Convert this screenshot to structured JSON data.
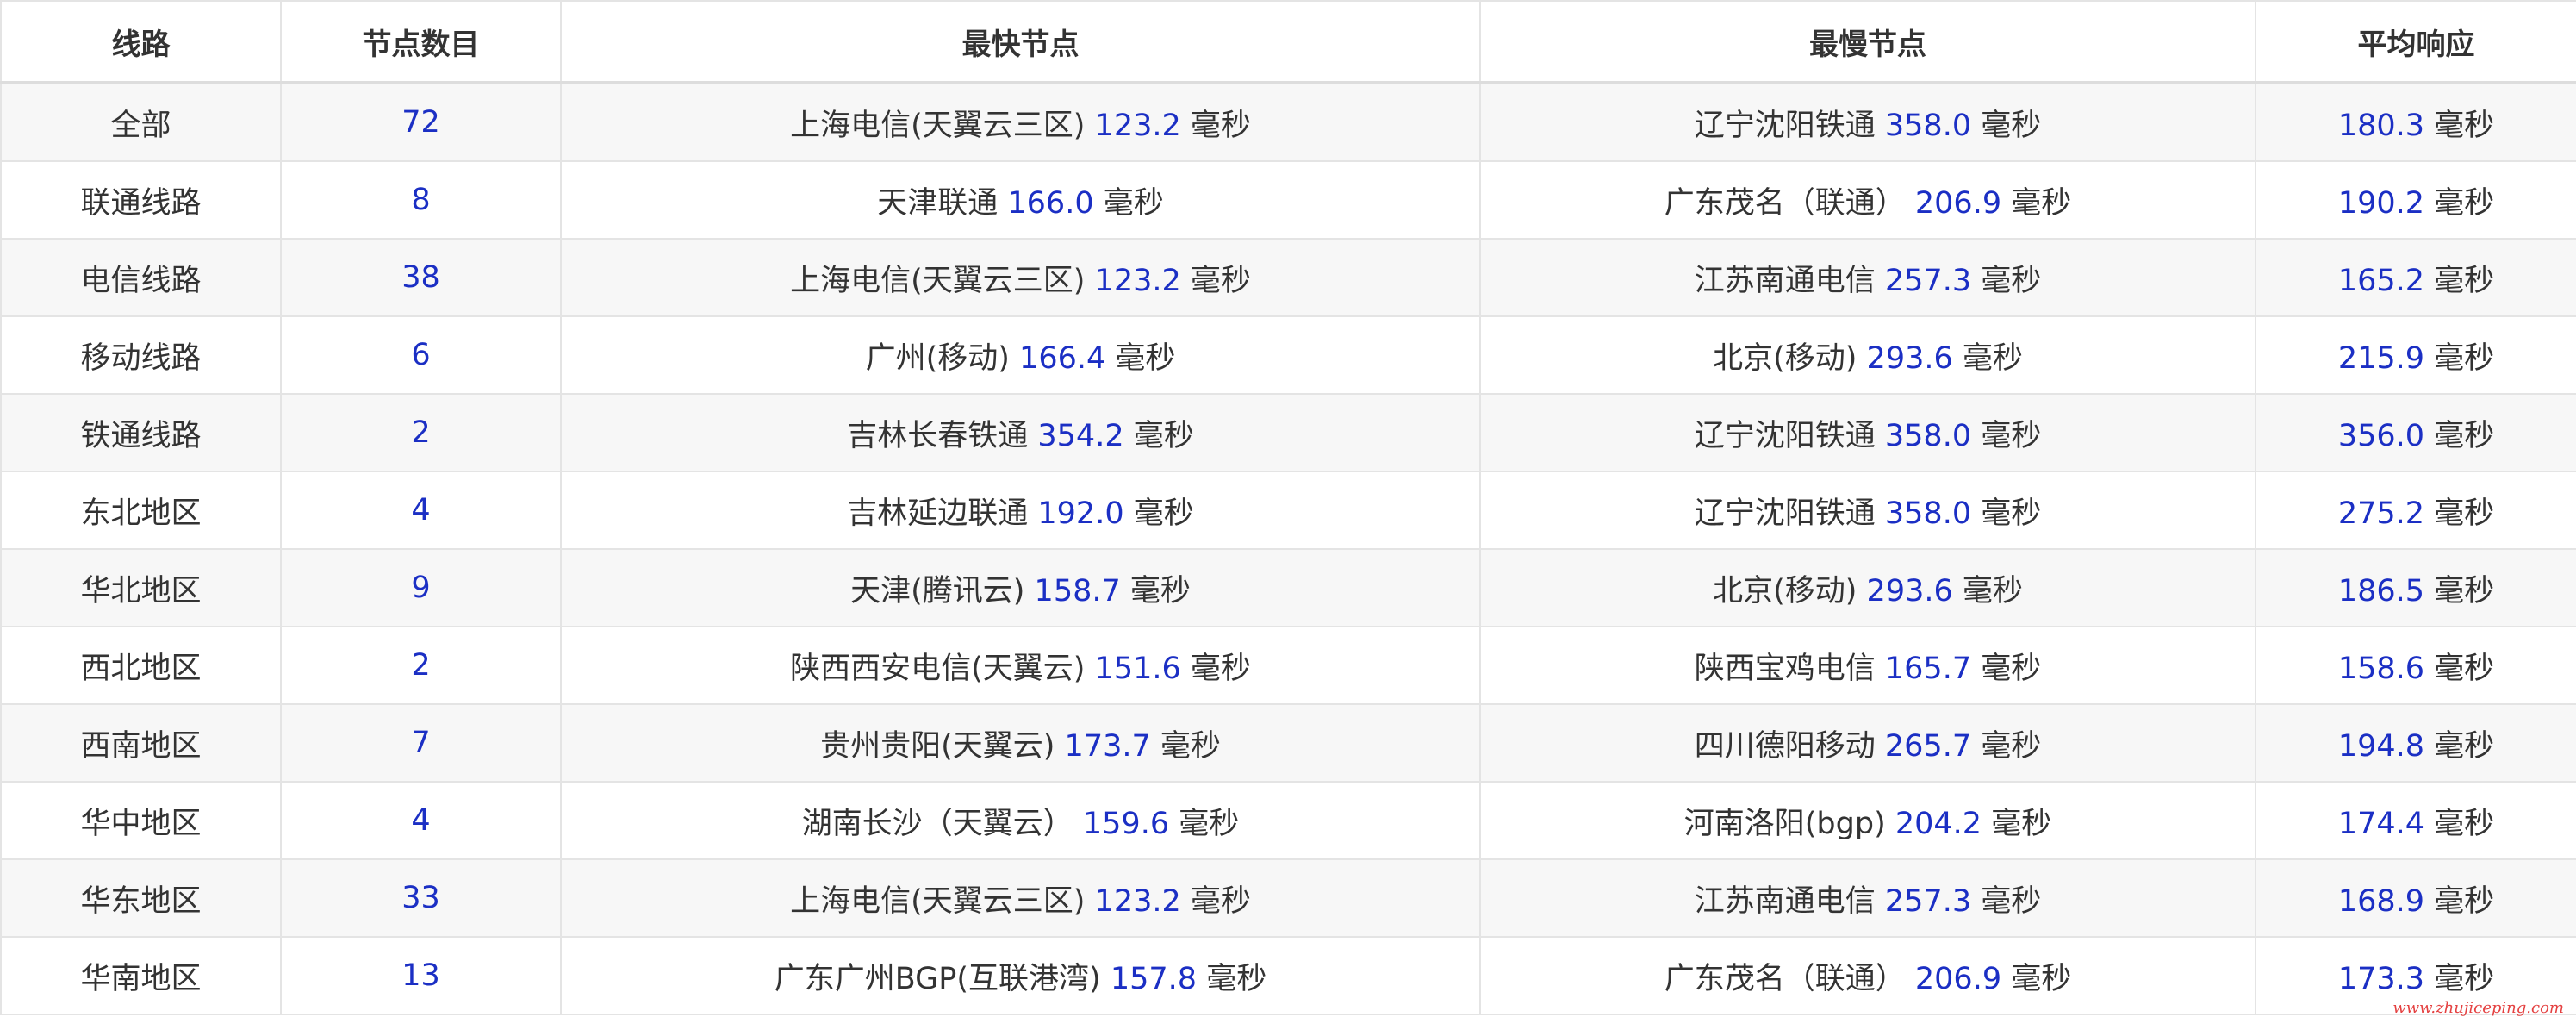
{
  "table": {
    "headers": [
      "线路",
      "节点数目",
      "最快节点",
      "最慢节点",
      "平均响应"
    ],
    "unit": "毫秒",
    "rows": [
      {
        "line": "全部",
        "count": "72",
        "fastest_node": "上海电信(天翼云三区)",
        "fastest_ms": "123.2",
        "slowest_node": "辽宁沈阳铁通",
        "slowest_ms": "358.0",
        "avg_ms": "180.3"
      },
      {
        "line": "联通线路",
        "count": "8",
        "fastest_node": "天津联通",
        "fastest_ms": "166.0",
        "slowest_node": "广东茂名（联通）",
        "slowest_ms": "206.9",
        "avg_ms": "190.2"
      },
      {
        "line": "电信线路",
        "count": "38",
        "fastest_node": "上海电信(天翼云三区)",
        "fastest_ms": "123.2",
        "slowest_node": "江苏南通电信",
        "slowest_ms": "257.3",
        "avg_ms": "165.2"
      },
      {
        "line": "移动线路",
        "count": "6",
        "fastest_node": "广州(移动)",
        "fastest_ms": "166.4",
        "slowest_node": "北京(移动)",
        "slowest_ms": "293.6",
        "avg_ms": "215.9"
      },
      {
        "line": "铁通线路",
        "count": "2",
        "fastest_node": "吉林长春铁通",
        "fastest_ms": "354.2",
        "slowest_node": "辽宁沈阳铁通",
        "slowest_ms": "358.0",
        "avg_ms": "356.0"
      },
      {
        "line": "东北地区",
        "count": "4",
        "fastest_node": "吉林延边联通",
        "fastest_ms": "192.0",
        "slowest_node": "辽宁沈阳铁通",
        "slowest_ms": "358.0",
        "avg_ms": "275.2"
      },
      {
        "line": "华北地区",
        "count": "9",
        "fastest_node": "天津(腾讯云)",
        "fastest_ms": "158.7",
        "slowest_node": "北京(移动)",
        "slowest_ms": "293.6",
        "avg_ms": "186.5"
      },
      {
        "line": "西北地区",
        "count": "2",
        "fastest_node": "陕西西安电信(天翼云)",
        "fastest_ms": "151.6",
        "slowest_node": "陕西宝鸡电信",
        "slowest_ms": "165.7",
        "avg_ms": "158.6"
      },
      {
        "line": "西南地区",
        "count": "7",
        "fastest_node": "贵州贵阳(天翼云)",
        "fastest_ms": "173.7",
        "slowest_node": "四川德阳移动",
        "slowest_ms": "265.7",
        "avg_ms": "194.8"
      },
      {
        "line": "华中地区",
        "count": "4",
        "fastest_node": "湖南长沙（天翼云）",
        "fastest_ms": "159.6",
        "slowest_node": "河南洛阳(bgp)",
        "slowest_ms": "204.2",
        "avg_ms": "174.4"
      },
      {
        "line": "华东地区",
        "count": "33",
        "fastest_node": "上海电信(天翼云三区)",
        "fastest_ms": "123.2",
        "slowest_node": "江苏南通电信",
        "slowest_ms": "257.3",
        "avg_ms": "168.9"
      },
      {
        "line": "华南地区",
        "count": "13",
        "fastest_node": "广东广州BGP(互联港湾)",
        "fastest_ms": "157.8",
        "slowest_node": "广东茂名（联通）",
        "slowest_ms": "206.9",
        "avg_ms": "173.3"
      }
    ]
  },
  "watermark": "www.zhujiceping.com",
  "colors": {
    "number": "#1b2fc4",
    "text": "#333333",
    "stripe": "#f7f7f7",
    "border": "#e4e4e4"
  }
}
